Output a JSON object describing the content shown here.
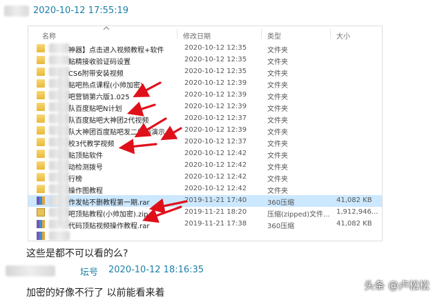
{
  "message1": {
    "timestamp": "2020-10-12 17:55:19"
  },
  "explorer": {
    "columns": {
      "name": "名称",
      "modified": "修改日期",
      "type": "类型",
      "size": "大小"
    },
    "rows": [
      {
        "name": "神器】点击进入视频教程+软件",
        "date": "2020-10-12 12:35",
        "type": "文件夹",
        "size": "",
        "icon": "folder"
      },
      {
        "name": "贴精接收验证码设置",
        "date": "2020-10-12 12:35",
        "type": "文件夹",
        "size": "",
        "icon": "folder"
      },
      {
        "name": "CS6附带安装视频",
        "date": "2020-10-12 12:35",
        "type": "文件夹",
        "size": "",
        "icon": "folder"
      },
      {
        "name": "贴吧热点课程(小帅加密)",
        "date": "2020-10-12 12:39",
        "type": "文件夹",
        "size": "",
        "icon": "folder"
      },
      {
        "name": "吧营销第六版1.025",
        "date": "2020-10-12 12:39",
        "type": "文件夹",
        "size": "",
        "icon": "folder"
      },
      {
        "name": "队百度贴吧N计划",
        "date": "2020-10-12 12:39",
        "type": "文件夹",
        "size": "",
        "icon": "folder"
      },
      {
        "name": "队百度贴吧大神团2代视频",
        "date": "2020-10-12 12:37",
        "type": "文件夹",
        "size": "",
        "icon": "folder"
      },
      {
        "name": "队大神团百度贴吧发二维码演示",
        "date": "2020-10-12 12:39",
        "type": "文件夹",
        "size": "",
        "icon": "folder"
      },
      {
        "name": "校3代教学视频",
        "date": "2020-10-12 12:37",
        "type": "文件夹",
        "size": "",
        "icon": "folder"
      },
      {
        "name": "贴顶贴软件",
        "date": "2020-10-12 12:42",
        "type": "文件夹",
        "size": "",
        "icon": "folder"
      },
      {
        "name": "动检测拨号",
        "date": "2020-10-12 12:42",
        "type": "文件夹",
        "size": "",
        "icon": "folder"
      },
      {
        "name": "行榜",
        "date": "2020-10-12 12:42",
        "type": "文件夹",
        "size": "",
        "icon": "folder"
      },
      {
        "name": "操作图教程",
        "date": "2020-10-12 12:42",
        "type": "文件夹",
        "size": "",
        "icon": "folder"
      },
      {
        "name": "作发帖不删教程第一期.rar",
        "date": "2019-11-21 17:40",
        "type": "360压缩",
        "size": "41,082 KB",
        "icon": "rar",
        "selected": true
      },
      {
        "name": "吧顶贴教程(小帅加密).zip",
        "date": "2019-11-21 18:20",
        "type": "压缩(zipped)文件...",
        "size": "1,912,946...",
        "icon": "zip"
      },
      {
        "name": "代码顶贴视频操作教程.rar",
        "date": "2019-11-21 17:38",
        "type": "360压缩",
        "size": "41,082 KB",
        "icon": "rar"
      },
      {
        "name": "",
        "date": "",
        "type": "",
        "size": "",
        "icon": "rar"
      }
    ]
  },
  "chat": {
    "reply1": "这些是都不可以看的么?",
    "msg2_name_partial": "坛号",
    "msg2_timestamp": "2020-10-12 18:16:35",
    "reply2": "加密的好像不行了 以前能看来着"
  },
  "watermark": "头条 @卢松松",
  "colors": {
    "timestamp": "#1a7fa8",
    "arrow": "#e0101a",
    "selection": "#cce8ff"
  }
}
